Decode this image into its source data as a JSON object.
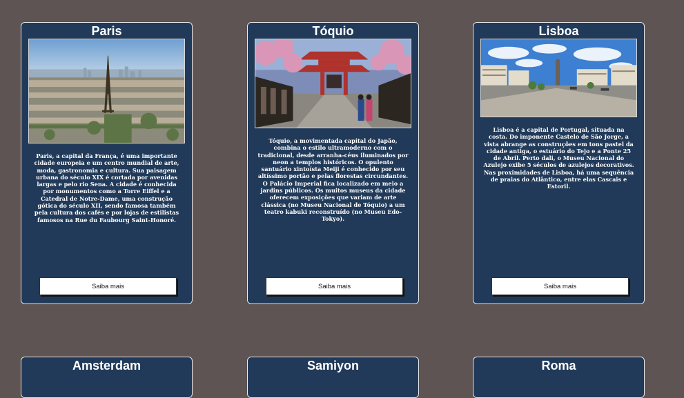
{
  "cards": [
    {
      "title": "Paris",
      "text": "Paris, a capital da França, é uma importante cidade europeia e um centro mundial de arte, moda, gastronomia e cultura. Sua paisagem urbana do século XIX é cortada por avenidas largas e pelo rio Sena. A cidade é conhecida por monumentos como a Torre Eiffel e a Catedral de Notre-Dame, uma construção gótica do século XII, sendo famosa também pela cultura dos cafés e por lojas de estilistas famosos na Rue du Faubourg Saint-Honoré.",
      "button": "Saiba mais"
    },
    {
      "title": "Tóquio",
      "text": "Tóquio, a movimentada capital do Japão, combina o estilo ultramoderno com o tradicional, desde arranha-céus iluminados por neon a templos históricos. O opulento santuário xintoísta Meiji é conhecido por seu altíssimo portão e pelas florestas circundantes. O Palácio Imperial fica localizado em meio a jardins públicos. Os muitos museus da cidade oferecem exposições que variam de arte clássica (no Museu Nacional de Tóquio) a um teatro kabuki reconstruído (no Museu Edo-Tokyo).",
      "button": "Saiba mais"
    },
    {
      "title": "Lisboa",
      "text": "Lisboa é a capital de Portugal, situada na costa. Do imponente Castelo de São Jorge, a vista abrange as construções em tons pastel da cidade antiga, o estuário do Tejo e a Ponte 25 de Abril. Perto dali, o Museu Nacional do Azulejo exibe 5 séculos de azulejos decorativos. Nas proximidades de Lisboa, há uma sequência de praias do Atlântico, entre elas Cascais e Estoril.",
      "button": "Saiba mais"
    },
    {
      "title": "Amsterdam"
    },
    {
      "title": "Samiyon"
    },
    {
      "title": "Roma"
    }
  ]
}
